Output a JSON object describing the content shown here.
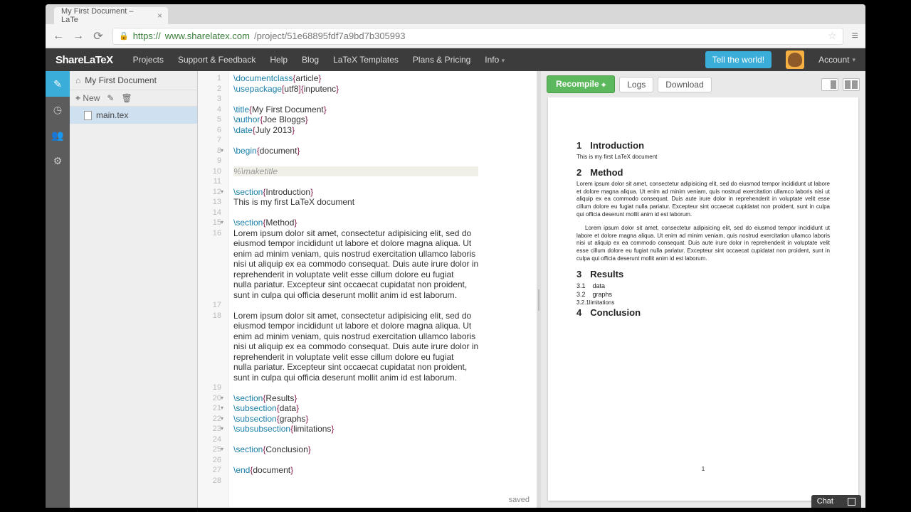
{
  "browser": {
    "tab_title": "My First Document – LaTe",
    "url_scheme": "https://",
    "url_host": "www.sharelatex.com",
    "url_path": "/project/51e68895fdf7a9bd7b305993"
  },
  "nav": {
    "brand": "ShareLaTeX",
    "items": [
      "Projects",
      "Support & Feedback",
      "Help",
      "Blog",
      "LaTeX Templates",
      "Plans & Pricing",
      "Info"
    ],
    "tell": "Tell the world!",
    "account": "Account"
  },
  "files": {
    "project": "My First Document",
    "new": "New",
    "file": "main.tex"
  },
  "editor": {
    "lines": [
      {
        "n": "1",
        "seg": [
          [
            "cmd",
            "\\documentclass"
          ],
          [
            "br",
            "{"
          ],
          [
            "arg",
            "article"
          ],
          [
            "br",
            "}"
          ]
        ]
      },
      {
        "n": "2",
        "seg": [
          [
            "cmd",
            "\\usepackage"
          ],
          [
            "br",
            "["
          ],
          [
            "arg",
            "utf8"
          ],
          [
            "br",
            "]{"
          ],
          [
            "arg",
            "inputenc"
          ],
          [
            "br",
            "}"
          ]
        ]
      },
      {
        "n": "3",
        "seg": []
      },
      {
        "n": "4",
        "seg": [
          [
            "cmd",
            "\\title"
          ],
          [
            "br",
            "{"
          ],
          [
            "arg",
            "My First Document"
          ],
          [
            "br",
            "}"
          ]
        ]
      },
      {
        "n": "5",
        "seg": [
          [
            "cmd",
            "\\author"
          ],
          [
            "br",
            "{"
          ],
          [
            "arg",
            "Joe Bloggs"
          ],
          [
            "br",
            "}"
          ]
        ]
      },
      {
        "n": "6",
        "seg": [
          [
            "cmd",
            "\\date"
          ],
          [
            "br",
            "{"
          ],
          [
            "arg",
            "July 2013"
          ],
          [
            "br",
            "}"
          ]
        ]
      },
      {
        "n": "7",
        "seg": []
      },
      {
        "n": "8",
        "fold": true,
        "seg": [
          [
            "cmd",
            "\\begin"
          ],
          [
            "br",
            "{"
          ],
          [
            "arg",
            "document"
          ],
          [
            "br",
            "}"
          ]
        ]
      },
      {
        "n": "9",
        "seg": []
      },
      {
        "n": "10",
        "hl": true,
        "seg": [
          [
            "comment",
            "%\\maketitle"
          ]
        ]
      },
      {
        "n": "11",
        "seg": []
      },
      {
        "n": "12",
        "fold": true,
        "seg": [
          [
            "cmd",
            "\\section"
          ],
          [
            "br",
            "{"
          ],
          [
            "arg",
            "Introduction"
          ],
          [
            "br",
            "}"
          ]
        ]
      },
      {
        "n": "13",
        "seg": [
          [
            "arg",
            "This is my first LaTeX document"
          ]
        ]
      },
      {
        "n": "14",
        "seg": []
      },
      {
        "n": "15",
        "fold": true,
        "seg": [
          [
            "cmd",
            "\\section"
          ],
          [
            "br",
            "{"
          ],
          [
            "arg",
            "Method"
          ],
          [
            "br",
            "}"
          ]
        ]
      },
      {
        "n": "16",
        "seg": [
          [
            "arg",
            "Lorem ipsum dolor sit amet, consectetur adipisicing elit, sed do"
          ]
        ]
      },
      {
        "n": "",
        "seg": [
          [
            "arg",
            "eiusmod tempor incididunt ut labore et dolore magna aliqua. Ut"
          ]
        ]
      },
      {
        "n": "",
        "seg": [
          [
            "arg",
            "enim ad minim veniam, quis nostrud exercitation ullamco laboris"
          ]
        ]
      },
      {
        "n": "",
        "seg": [
          [
            "arg",
            "nisi ut aliquip ex ea commodo consequat. Duis aute irure dolor in"
          ]
        ]
      },
      {
        "n": "",
        "seg": [
          [
            "arg",
            "reprehenderit in voluptate velit esse cillum dolore eu fugiat"
          ]
        ]
      },
      {
        "n": "",
        "seg": [
          [
            "arg",
            "nulla pariatur. Excepteur sint occaecat cupidatat non proident,"
          ]
        ]
      },
      {
        "n": "",
        "seg": [
          [
            "arg",
            "sunt in culpa qui officia deserunt mollit anim id est laborum."
          ]
        ]
      },
      {
        "n": "17",
        "seg": []
      },
      {
        "n": "18",
        "seg": [
          [
            "arg",
            "Lorem ipsum dolor sit amet, consectetur adipisicing elit, sed do"
          ]
        ]
      },
      {
        "n": "",
        "seg": [
          [
            "arg",
            "eiusmod tempor incididunt ut labore et dolore magna aliqua. Ut"
          ]
        ]
      },
      {
        "n": "",
        "seg": [
          [
            "arg",
            "enim ad minim veniam, quis nostrud exercitation ullamco laboris"
          ]
        ]
      },
      {
        "n": "",
        "seg": [
          [
            "arg",
            "nisi ut aliquip ex ea commodo consequat. Duis aute irure dolor in"
          ]
        ]
      },
      {
        "n": "",
        "seg": [
          [
            "arg",
            "reprehenderit in voluptate velit esse cillum dolore eu fugiat"
          ]
        ]
      },
      {
        "n": "",
        "seg": [
          [
            "arg",
            "nulla pariatur. Excepteur sint occaecat cupidatat non proident,"
          ]
        ]
      },
      {
        "n": "",
        "seg": [
          [
            "arg",
            "sunt in culpa qui officia deserunt mollit anim id est laborum."
          ]
        ]
      },
      {
        "n": "19",
        "seg": []
      },
      {
        "n": "20",
        "fold": true,
        "seg": [
          [
            "cmd",
            "\\section"
          ],
          [
            "br",
            "{"
          ],
          [
            "arg",
            "Results"
          ],
          [
            "br",
            "}"
          ]
        ]
      },
      {
        "n": "21",
        "fold": true,
        "seg": [
          [
            "cmd",
            "\\subsection"
          ],
          [
            "br",
            "{"
          ],
          [
            "arg",
            "data"
          ],
          [
            "br",
            "}"
          ]
        ]
      },
      {
        "n": "22",
        "fold": true,
        "seg": [
          [
            "cmd",
            "\\subsection"
          ],
          [
            "br",
            "{"
          ],
          [
            "arg",
            "graphs"
          ],
          [
            "br",
            "}"
          ]
        ]
      },
      {
        "n": "23",
        "fold": true,
        "seg": [
          [
            "cmd",
            "\\subsubsection"
          ],
          [
            "br",
            "{"
          ],
          [
            "arg",
            "limitations"
          ],
          [
            "br",
            "}"
          ]
        ]
      },
      {
        "n": "24",
        "seg": []
      },
      {
        "n": "25",
        "fold": true,
        "seg": [
          [
            "cmd",
            "\\section"
          ],
          [
            "br",
            "{"
          ],
          [
            "arg",
            "Conclusion"
          ],
          [
            "br",
            "}"
          ]
        ]
      },
      {
        "n": "26",
        "seg": []
      },
      {
        "n": "27",
        "seg": [
          [
            "cmd",
            "\\end"
          ],
          [
            "br",
            "{"
          ],
          [
            "arg",
            "document"
          ],
          [
            "br",
            "}"
          ]
        ]
      },
      {
        "n": "28",
        "seg": []
      }
    ],
    "status": "saved"
  },
  "preview": {
    "recompile": "Recompile",
    "logs": "Logs",
    "download": "Download"
  },
  "pdf": {
    "s1_num": "1",
    "s1_title": "Introduction",
    "s1_body": "This is my first LaTeX document",
    "s2_num": "2",
    "s2_title": "Method",
    "s2_body1": "Lorem ipsum dolor sit amet, consectetur adipisicing elit, sed do eiusmod tempor incididunt ut labore et dolore magna aliqua. Ut enim ad minim veniam, quis nostrud exercitation ullamco laboris nisi ut aliquip ex ea commodo consequat. Duis aute irure dolor in reprehenderit in voluptate velit esse cillum dolore eu fugiat nulla pariatur. Excepteur sint occaecat cupidatat non proident, sunt in culpa qui officia deserunt mollit anim id est laborum.",
    "s2_body2": "Lorem ipsum dolor sit amet, consectetur adipisicing elit, sed do eiusmod tempor incididunt ut labore et dolore magna aliqua. Ut enim ad minim veniam, quis nostrud exercitation ullamco laboris nisi ut aliquip ex ea commodo consequat. Duis aute irure dolor in reprehenderit in voluptate velit esse cillum dolore eu fugiat nulla pariatur. Excepteur sint occaecat cupidatat non proident, sunt in culpa qui officia deserunt mollit anim id est laborum.",
    "s3_num": "3",
    "s3_title": "Results",
    "s31_num": "3.1",
    "s31_title": "data",
    "s32_num": "3.2",
    "s32_title": "graphs",
    "s321_num": "3.2.1",
    "s321_title": "limitations",
    "s4_num": "4",
    "s4_title": "Conclusion",
    "page": "1"
  },
  "chat": "Chat"
}
